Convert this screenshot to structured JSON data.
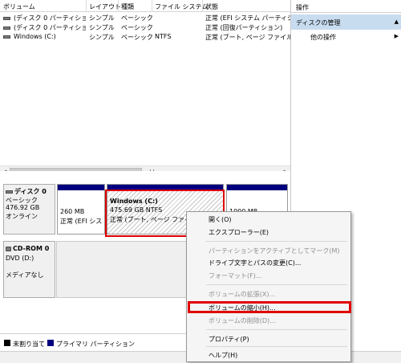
{
  "volume_list": {
    "columns": [
      "ボリューム",
      "レイアウト",
      "種類",
      "ファイル システム",
      "状態"
    ],
    "rows": [
      {
        "volume": "(ディスク 0 パーティション 1)",
        "layout": "シンプル",
        "type": "ベーシック",
        "fs": "",
        "status": "正常 (EFI システム パーティション"
      },
      {
        "volume": "(ディスク 0 パーティション 4)",
        "layout": "シンプル",
        "type": "ベーシック",
        "fs": "",
        "status": "正常 (回復パーティション)"
      },
      {
        "volume": "Windows (C:)",
        "layout": "シンプル",
        "type": "ベーシック",
        "fs": "NTFS",
        "status": "正常 (ブート, ページ ファイル, ク"
      }
    ]
  },
  "actions": {
    "header": "操作",
    "section": "ディスクの管理",
    "section_caret": "▲",
    "item": "他の操作",
    "item_caret": "▶"
  },
  "disk0": {
    "name": "ディスク 0",
    "type": "ベーシック",
    "size": "476.92 GB",
    "state": "オンライン",
    "partitions": [
      {
        "size": "260 MB",
        "status": "正常 (EFI シス"
      },
      {
        "name": "Windows  (C:)",
        "size": "475.69 GB NTFS",
        "status": "正常 (ブート, ページ ファイル,"
      },
      {
        "size": "1000 MB"
      }
    ]
  },
  "cdrom0": {
    "name": "CD-ROM 0",
    "drive": "DVD (D:)",
    "media": "メディアなし"
  },
  "legend": {
    "unallocated": "未割り当て",
    "primary": "プライマリ パーティション",
    "unallocated_color": "#000000",
    "primary_color": "#00007f"
  },
  "context_menu": {
    "items": [
      {
        "label": "開く(O)",
        "enabled": true
      },
      {
        "label": "エクスプローラー(E)",
        "enabled": true
      },
      {
        "label": "パーティションをアクティブとしてマーク(M)",
        "enabled": false
      },
      {
        "label": "ドライブ文字とパスの変更(C)...",
        "enabled": true
      },
      {
        "label": "フォーマット(F)...",
        "enabled": false
      },
      {
        "label": "ボリュームの拡張(X)...",
        "enabled": false
      },
      {
        "label": "ボリュームの縮小(H)...",
        "enabled": true
      },
      {
        "label": "ボリュームの削除(D)...",
        "enabled": false
      },
      {
        "label": "プロパティ(P)",
        "enabled": true
      },
      {
        "label": "ヘルプ(H)",
        "enabled": true
      }
    ]
  },
  "highlight_color": "#e00000"
}
